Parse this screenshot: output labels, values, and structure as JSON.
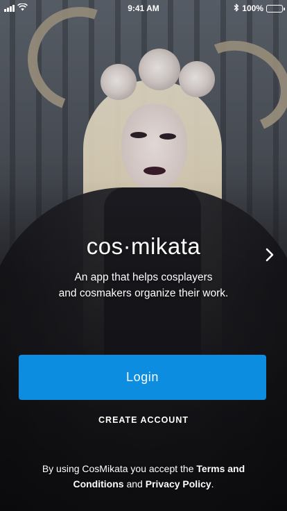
{
  "status_bar": {
    "time": "9:41 AM",
    "battery_label": "100%",
    "battery_level": 1.0,
    "icons": [
      "signal-icon",
      "wifi-icon",
      "bluetooth-icon",
      "battery-icon"
    ]
  },
  "main": {
    "brand_name": "cos·mikata",
    "tagline_line1": "An app that helps cosplayers",
    "tagline_line2": "and cosmakers organize their work.",
    "next_icon": "chevron-right-icon"
  },
  "actions": {
    "login_label": "Login",
    "create_account_label": "CREATE ACCOUNT"
  },
  "legal": {
    "prefix": "By using CosMikata you accept the ",
    "terms_label": "Terms and Conditions",
    "conjunction": " and ",
    "privacy_label": "Privacy Policy",
    "suffix": "."
  },
  "colors": {
    "primary_button": "#0c8de0",
    "text": "#ffffff"
  }
}
